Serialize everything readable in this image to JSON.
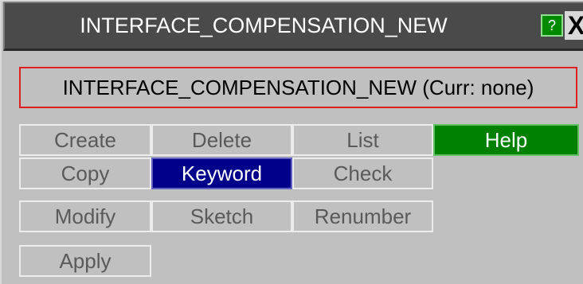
{
  "window": {
    "title": "INTERFACE_COMPENSATION_NEW",
    "help_icon": "?",
    "close_icon": "X"
  },
  "selection": {
    "text": "INTERFACE_COMPENSATION_NEW (Curr: none)"
  },
  "buttons": {
    "create": "Create",
    "delete": "Delete",
    "list": "List",
    "help": "Help",
    "copy": "Copy",
    "keyword": "Keyword",
    "check": "Check",
    "modify": "Modify",
    "sketch": "Sketch",
    "renumber": "Renumber",
    "apply": "Apply"
  },
  "colors": {
    "title_bg": "#4a4a4a",
    "active_button": "#00008a",
    "help_button": "#008000",
    "selection_border": "#e02020"
  }
}
